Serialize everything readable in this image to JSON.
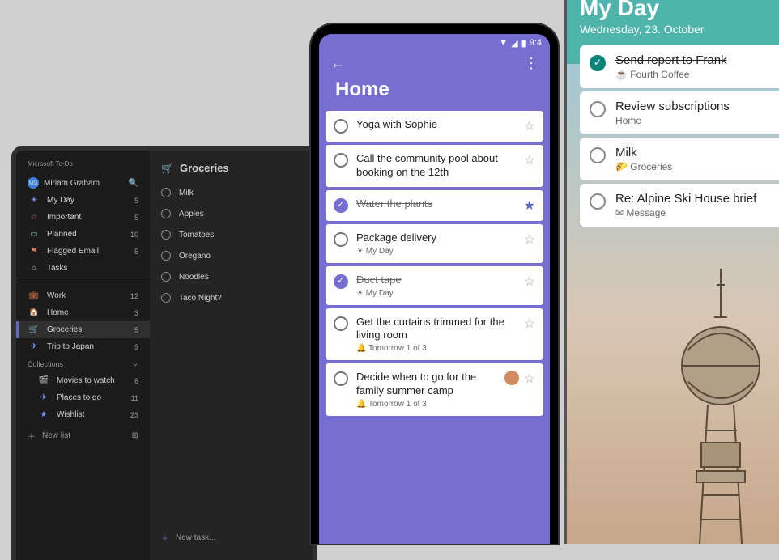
{
  "desktop": {
    "brand": "Microsoft To-Do",
    "user": "Miriam Graham",
    "nav": [
      {
        "icon": "☀",
        "label": "My Day",
        "count": 5,
        "color": "#7aa0ff"
      },
      {
        "icon": "☆",
        "label": "Important",
        "count": 5,
        "color": "#d97aa0"
      },
      {
        "icon": "▭",
        "label": "Planned",
        "count": 10,
        "color": "#6fc3a0"
      },
      {
        "icon": "⚑",
        "label": "Flagged Email",
        "count": 5,
        "color": "#d07a5c"
      },
      {
        "icon": "⌂",
        "label": "Tasks",
        "count": "",
        "color": "#b0b0b0"
      }
    ],
    "lists": [
      {
        "icon": "💼",
        "label": "Work",
        "count": 12
      },
      {
        "icon": "🏠",
        "label": "Home",
        "count": 3
      },
      {
        "icon": "🛒",
        "label": "Groceries",
        "count": 5,
        "active": true
      },
      {
        "icon": "✈",
        "label": "Trip to Japan",
        "count": 9
      }
    ],
    "collections_label": "Collections",
    "collections": [
      {
        "icon": "🎬",
        "label": "Movies to watch",
        "count": 6
      },
      {
        "icon": "✈",
        "label": "Places to go",
        "count": 11
      },
      {
        "icon": "★",
        "label": "Wishlist",
        "count": 23
      }
    ],
    "new_list": "New list",
    "main": {
      "icon": "🛒",
      "title": "Groceries",
      "tasks": [
        "Milk",
        "Apples",
        "Tomatoes",
        "Oregano",
        "Noodles",
        "Taco Night?"
      ],
      "new_task": "New task..."
    }
  },
  "phoneA": {
    "time": "9:4",
    "title": "Home",
    "tasks": [
      {
        "title": "Yoga with Sophie",
        "done": false,
        "star": false
      },
      {
        "title": "Call the community pool about booking on the 12th",
        "done": false,
        "star": false
      },
      {
        "title": "Water the plants",
        "done": true,
        "star": true
      },
      {
        "title": "Package delivery",
        "sub": "☀ My Day",
        "done": false,
        "star": false
      },
      {
        "title": "Duct tape",
        "sub": "☀ My Day",
        "done": true,
        "star": false
      },
      {
        "title": "Get the curtains trimmed for the living room",
        "sub": "🔔 Tomorrow 1 of 3",
        "done": false,
        "star": false
      },
      {
        "title": "Decide when to go for the family summer camp",
        "sub": "🔔 Tomorrow 1 of 3",
        "done": false,
        "star": false,
        "avatar": true
      }
    ]
  },
  "phoneB": {
    "title": "My Day",
    "date": "Wednesday, 23. October",
    "tasks": [
      {
        "title": "Send report to Frank",
        "sub": "☕ Fourth Coffee",
        "done": true
      },
      {
        "title": "Review subscriptions",
        "sub": "Home",
        "done": false
      },
      {
        "title": "Milk",
        "sub": "🌮 Groceries",
        "done": false
      },
      {
        "title": "Re: Alpine Ski House brief",
        "sub": "✉ Message",
        "done": false
      }
    ]
  }
}
